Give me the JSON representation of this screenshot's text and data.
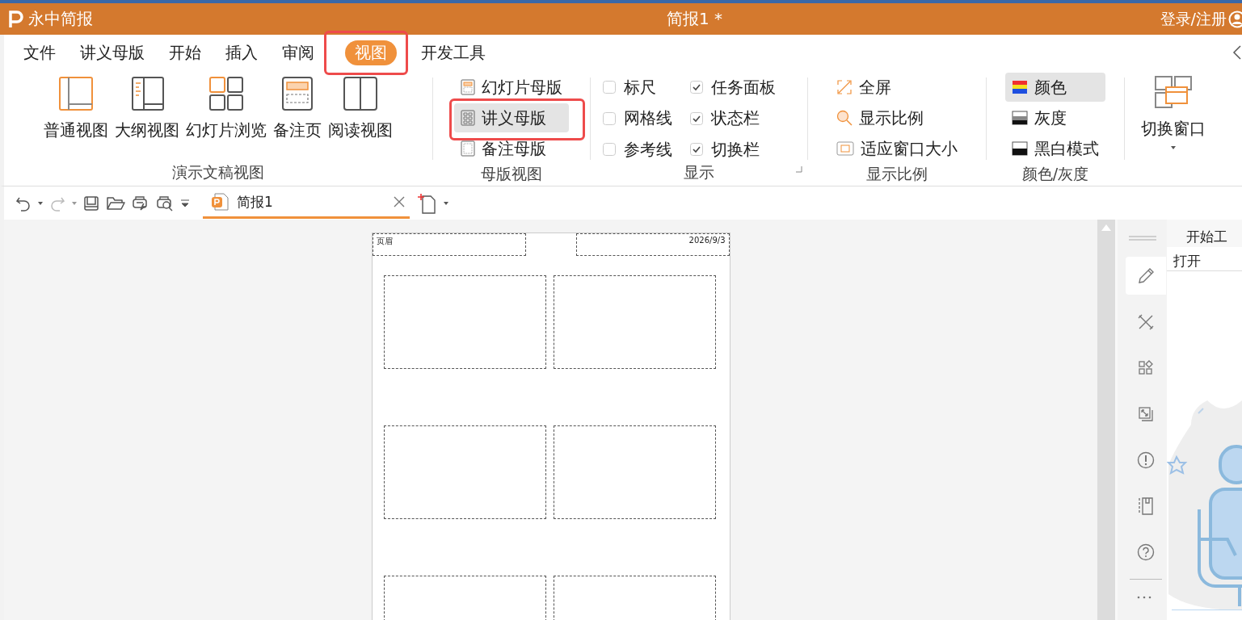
{
  "title_bar": {
    "app_name": "永中简报",
    "document_title": "简报1 *",
    "account": "登录/注册"
  },
  "menu_tabs": [
    {
      "label": "文件",
      "selected": false
    },
    {
      "label": "讲义母版",
      "selected": false
    },
    {
      "label": "开始",
      "selected": false
    },
    {
      "label": "插入",
      "selected": false
    },
    {
      "label": "审阅",
      "selected": false
    },
    {
      "label": "视图",
      "selected": true
    },
    {
      "label": "开发工具",
      "selected": false
    }
  ],
  "ribbon": {
    "presentation_views": {
      "label": "演示文稿视图",
      "buttons": [
        {
          "kind": "normal",
          "label": "普通视图"
        },
        {
          "kind": "outline",
          "label": "大纲视图"
        },
        {
          "kind": "sorter",
          "label": "幻灯片浏览"
        },
        {
          "kind": "notes",
          "label": "备注页"
        },
        {
          "kind": "reading",
          "label": "阅读视图"
        }
      ]
    },
    "master_views": {
      "label": "母版视图",
      "items": [
        {
          "kind": "slide",
          "label": "幻灯片母版",
          "selected": false
        },
        {
          "kind": "handout",
          "label": "讲义母版",
          "selected": true
        },
        {
          "kind": "notes",
          "label": "备注母版",
          "selected": false
        }
      ]
    },
    "show": {
      "label": "显示",
      "checkboxes": [
        {
          "label": "标尺",
          "checked": false
        },
        {
          "label": "任务面板",
          "checked": true
        },
        {
          "label": "网格线",
          "checked": false
        },
        {
          "label": "状态栏",
          "checked": true
        },
        {
          "label": "参考线",
          "checked": false
        },
        {
          "label": "切换栏",
          "checked": true
        }
      ]
    },
    "zoom": {
      "label": "显示比例",
      "items": [
        {
          "kind": "fullscreen",
          "label": "全屏"
        },
        {
          "kind": "zoom",
          "label": "显示比例"
        },
        {
          "kind": "fit",
          "label": "适应窗口大小"
        }
      ]
    },
    "color": {
      "label": "颜色/灰度",
      "items": [
        {
          "kind": "color",
          "label": "颜色",
          "selected": true
        },
        {
          "kind": "gray",
          "label": "灰度",
          "selected": false
        },
        {
          "kind": "bw",
          "label": "黑白模式",
          "selected": false
        }
      ]
    },
    "window": {
      "button": "切换窗口"
    }
  },
  "document_tab": {
    "title": "简报1"
  },
  "page": {
    "header": "页眉",
    "date": "2026/9/3"
  },
  "side_panel": {
    "title": "开始工",
    "section": "打开"
  }
}
